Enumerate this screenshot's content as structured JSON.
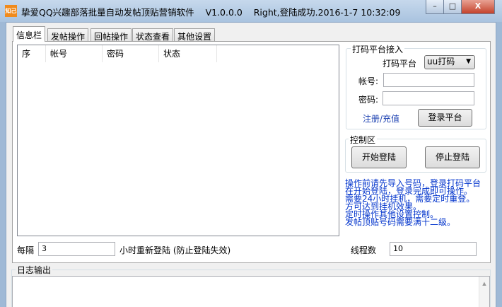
{
  "window": {
    "title": "挚爱QQ兴趣部落批量自动发帖顶贴营销软件    V1.0.0.0    Right,登陆成功.2016-1-7 10:32:09",
    "icon_text": "知己",
    "minimize": "–",
    "maximize": "□",
    "close": "X"
  },
  "tabs": [
    "信息栏",
    "发帖操作",
    "回帖操作",
    "状态查看",
    "其他设置"
  ],
  "list": {
    "columns": [
      "序",
      "帐号",
      "密码",
      "状态"
    ]
  },
  "captcha": {
    "group_label": "打码平台接入",
    "platform_label": "打码平台",
    "platform_value": "uu打码",
    "account_label": "帐号:",
    "account_value": "",
    "password_label": "密码:",
    "password_value": "",
    "register_link": "注册/充值",
    "login_button": "登录平台"
  },
  "control": {
    "group_label": "控制区",
    "start_button": "开始登陆",
    "stop_button": "停止登陆"
  },
  "notes": [
    "操作前请先导入号码，登录打码平台",
    "在开始登陆，登录完成即可操作。",
    "需要24小时挂机，需要定时重登。",
    "方可达到挂机效果。",
    "定时操作其他设置控制。",
    "发帖顶贴号码需要满十二级。"
  ],
  "relogin": {
    "prefix": "每隔",
    "value": "3",
    "suffix": "小时重新登陆 (防止登陆失效)"
  },
  "threads": {
    "label": "线程数",
    "value": "10"
  },
  "log": {
    "label": "日志输出",
    "content": ""
  }
}
